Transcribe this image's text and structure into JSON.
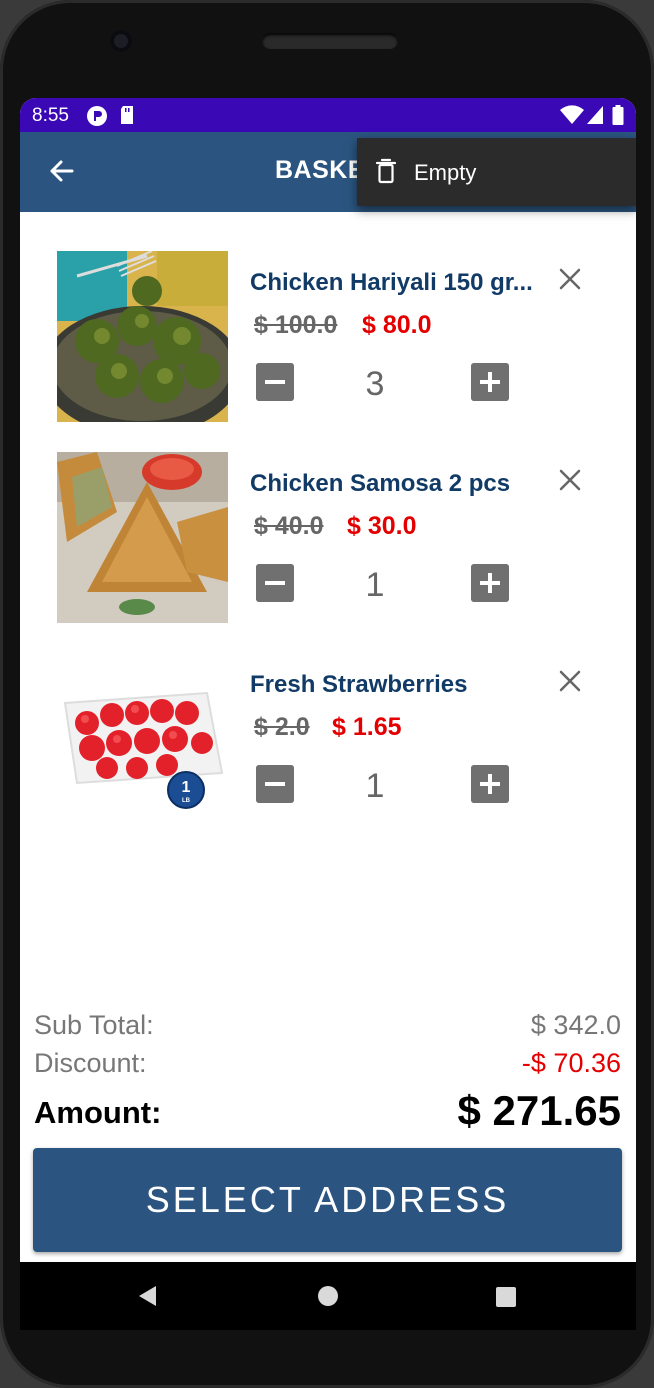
{
  "status_bar": {
    "time": "8:55"
  },
  "app_bar": {
    "title": "BASKET"
  },
  "overflow_menu": {
    "items": [
      {
        "label": "Empty"
      }
    ]
  },
  "cart": {
    "items": [
      {
        "name": "Chicken Hariyali 150 gr...",
        "old_price": "$ 100.0",
        "new_price": "$ 80.0",
        "quantity": "3"
      },
      {
        "name": "Chicken Samosa 2 pcs",
        "old_price": "$ 40.0",
        "new_price": "$ 30.0",
        "quantity": "1"
      },
      {
        "name": "Fresh Strawberries",
        "old_price": "$ 2.0",
        "new_price": "$ 1.65",
        "quantity": "1",
        "badge": "1 LB"
      }
    ]
  },
  "summary": {
    "subtotal_label": "Sub Total:",
    "subtotal_value": "$ 342.0",
    "discount_label": "Discount:",
    "discount_value": "-$ 70.36",
    "amount_label": "Amount:",
    "amount_value": "$ 271.65"
  },
  "cta": {
    "label": "SELECT ADDRESS"
  },
  "colors": {
    "status_bar": "#3b08b6",
    "app_bar": "#2b5580",
    "price_red": "#e40000",
    "title_blue": "#123a66"
  }
}
